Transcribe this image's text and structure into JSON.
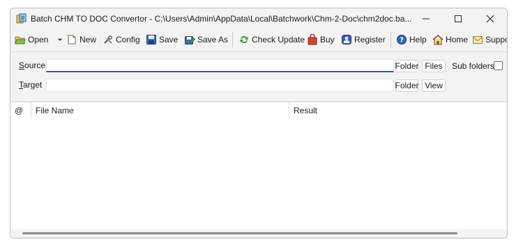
{
  "window": {
    "title": "Batch CHM TO DOC Convertor - C:\\Users\\Admin\\AppData\\Local\\Batchwork\\Chm-2-Doc\\chm2doc.ba..."
  },
  "toolbar": {
    "open": "Open",
    "new": "New",
    "config": "Config",
    "save": "Save",
    "save_as": "Save As",
    "check_update": "Check Update",
    "buy": "Buy",
    "register": "Register",
    "help": "Help",
    "home": "Home",
    "support": "Suppo"
  },
  "source": {
    "label_accel": "S",
    "label_rest": "ource",
    "value": "",
    "folder_button": "Folder",
    "files_button": "Files",
    "subfolders_label": "Sub folders",
    "subfolders_checked": false
  },
  "target": {
    "label_accel": "T",
    "label_rest": "arget",
    "value": "",
    "folder_button": "Folder",
    "view_button": "View"
  },
  "list": {
    "columns": [
      "@",
      "File Name",
      "Result"
    ],
    "rows": []
  },
  "colors": {
    "focus_underline": "#1f5fb0",
    "window_bg": "#f3f3f3"
  },
  "icons": {
    "app": "app-icon",
    "open": "open-folder-icon",
    "new": "new-file-icon",
    "config": "tools-icon",
    "save": "floppy-disk-icon",
    "save_as": "save-as-icon",
    "check_update": "refresh-icon",
    "buy": "shopping-bag-icon",
    "register": "register-icon",
    "help": "help-icon",
    "home": "home-icon",
    "support": "support-icon"
  }
}
